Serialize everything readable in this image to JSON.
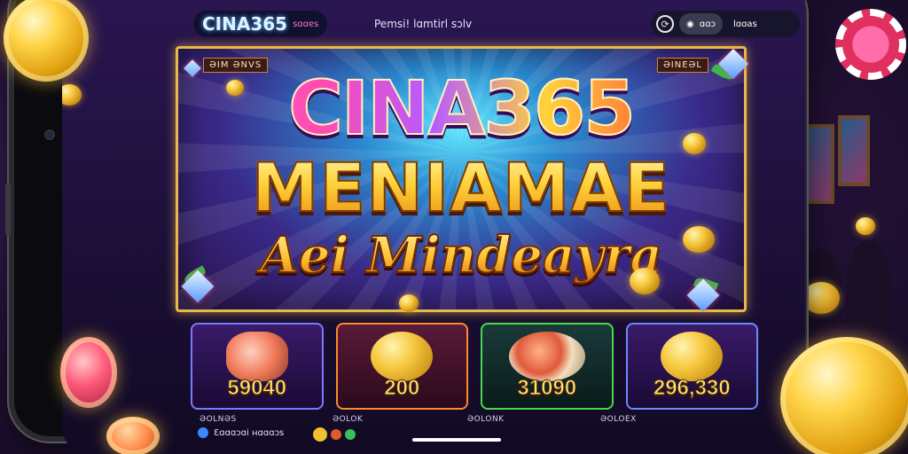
{
  "topbar": {
    "logo_text": "CINA365",
    "logo_sub": "sɑɑɐs",
    "nav_text": "Pemsi! lɑmtirl sɔlv",
    "pill_button": "ɑɑɔ",
    "pill_label": "lɑɑas"
  },
  "banner": {
    "corner_left": "ƏIM ƏNVS",
    "corner_right": "ƏINEƏL",
    "title_line1": "CINA365",
    "title_line2": "MENIAMAE",
    "title_line3": "Aei Mindeayra"
  },
  "cards": [
    {
      "value": "59040",
      "art": "salmon-icon"
    },
    {
      "value": "200",
      "art": "gold-coin-icon"
    },
    {
      "value": "31090",
      "art": "food-plate-icon"
    },
    {
      "value": "296,330",
      "art": "gold-coin-icon"
    }
  ],
  "bottom": {
    "labels": [
      "ƏOLNƏS",
      "ƏOLOK",
      "ƏOLONK",
      "ƏOLOEX"
    ],
    "link_text": "Ɛɑɑɑɔɑi ʜɑɑɑɔs"
  },
  "colors": {
    "accent_gold": "#ffd23a",
    "accent_pink": "#ff4bb0",
    "card_border_blue": "#7a7aff",
    "card_border_orange": "#ff8a2a",
    "card_border_green": "#4ad84a"
  }
}
